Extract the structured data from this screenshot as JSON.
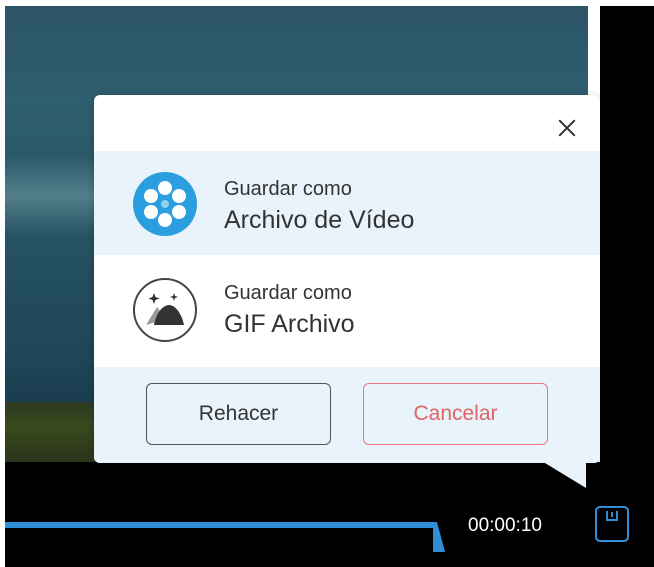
{
  "player": {
    "time": "00:00:10",
    "progress_fraction": 0.66,
    "accent_color": "#2f8ed8",
    "save_icon": "save-icon"
  },
  "dialog": {
    "close_icon": "close-icon",
    "options": [
      {
        "line1": "Guardar como",
        "line2": "Archivo de Vídeo",
        "icon": "film-reel-icon",
        "selected": true
      },
      {
        "line1": "Guardar como",
        "line2": "GIF Archivo",
        "icon": "gif-image-icon",
        "selected": false
      }
    ],
    "buttons": {
      "redo": "Rehacer",
      "cancel": "Cancelar"
    },
    "colors": {
      "highlight": "#e8f3fb",
      "cancel": "#e06464"
    }
  }
}
